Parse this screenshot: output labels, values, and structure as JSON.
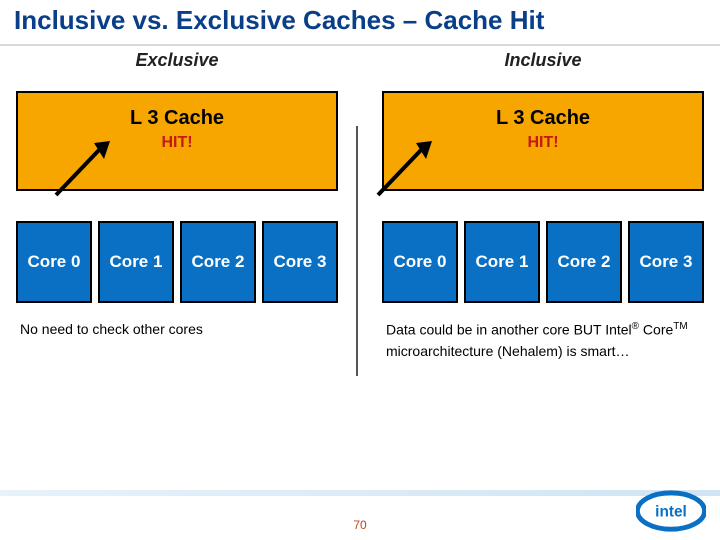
{
  "title": "Inclusive vs. Exclusive Caches – Cache Hit",
  "left": {
    "heading": "Exclusive",
    "l3_label": "L 3 Cache",
    "hit_label": "HIT!",
    "cores": [
      "Core 0",
      "Core 1",
      "Core 2",
      "Core 3"
    ],
    "caption": "No need to check other cores"
  },
  "right": {
    "heading": "Inclusive",
    "l3_label": "L 3 Cache",
    "hit_label": "HIT!",
    "cores": [
      "Core 0",
      "Core 1",
      "Core 2",
      "Core 3"
    ],
    "caption_html": "Data could be in another core BUT Intel® Core™ microarchitecture (Nehalem) is smart…"
  },
  "page_number": "70",
  "colors": {
    "l3_bg": "#f7a600",
    "core_bg": "#0a70c3",
    "title_color": "#083f88",
    "hit_color": "#c21919"
  }
}
